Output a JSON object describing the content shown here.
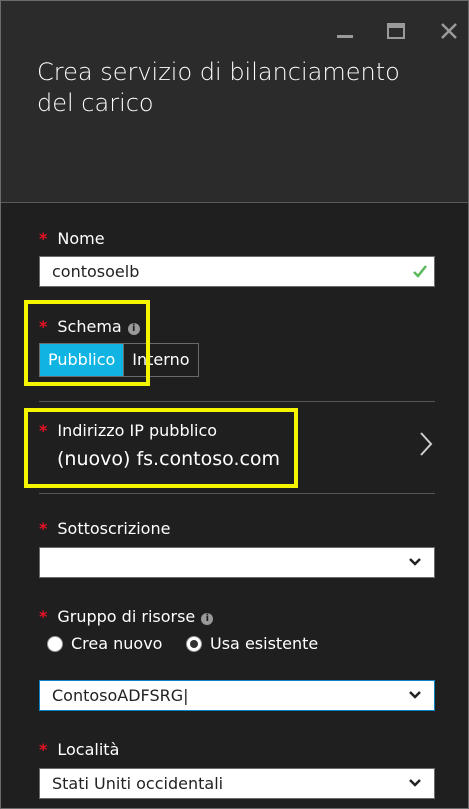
{
  "window": {
    "minimize_icon": "minimize-icon",
    "maximize_icon": "maximize-icon",
    "close_icon": "close-icon"
  },
  "blade": {
    "title": "Crea servizio di bilanciamento del carico"
  },
  "form": {
    "required_marker": "*",
    "nome": {
      "label": "Nome",
      "value": "contosoelb",
      "valid_icon": "check-icon"
    },
    "schema": {
      "label": "Schema",
      "info_icon": "info-icon",
      "info_glyph": "i",
      "options": [
        "Pubblico",
        "Interno"
      ],
      "selected": "Pubblico"
    },
    "public_ip": {
      "label": "Indirizzo IP pubblico",
      "value": "(nuovo) fs.contoso.com",
      "nav_icon": "chevron-right-icon"
    },
    "subscription": {
      "label": "Sottoscrizione",
      "value": ""
    },
    "resource_group": {
      "label": "Gruppo di risorse",
      "info_icon": "info-icon",
      "info_glyph": "i",
      "radio_options": [
        "Crea nuovo",
        "Usa esistente"
      ],
      "selected_radio": "Usa esistente",
      "value": "ContosoADFSRG"
    },
    "location": {
      "label": "Località",
      "value": "Stati Uniti occidentali"
    }
  },
  "colors": {
    "accent": "#0fb4e3",
    "highlight": "#f5f500",
    "required": "#e81123",
    "valid": "#5cb85c",
    "focus_border": "#0a84c8"
  }
}
